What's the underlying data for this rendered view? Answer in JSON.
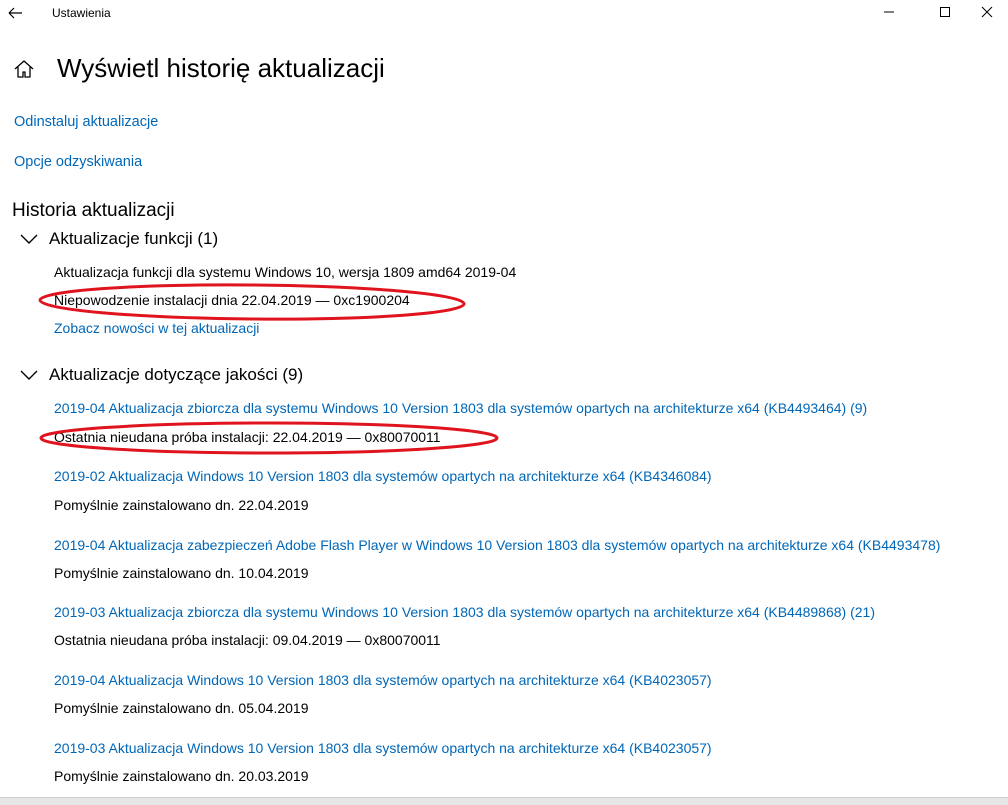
{
  "window": {
    "app_title": "Ustawienia"
  },
  "header": {
    "title": "Wyświetl historię aktualizacji"
  },
  "links": {
    "uninstall": "Odinstaluj aktualizacje",
    "recovery": "Opcje odzyskiwania"
  },
  "history": {
    "title": "Historia aktualizacji",
    "feature_group": {
      "title": "Aktualizacje funkcji (1)",
      "items": [
        {
          "name": "Aktualizacja funkcji dla systemu Windows 10, wersja 1809 amd64 2019-04",
          "status": "Niepowodzenie instalacji dnia 22.04.2019 — 0xc1900204",
          "link": "Zobacz nowości w tej aktualizacji"
        }
      ]
    },
    "quality_group": {
      "title": "Aktualizacje dotyczące jakości (9)",
      "items": [
        {
          "name": "2019-04 Aktualizacja zbiorcza dla systemu Windows 10 Version 1803 dla systemów opartych na architekturze x64 (KB4493464) (9)",
          "status": "Ostatnia nieudana próba instalacji: 22.04.2019 — 0x80070011"
        },
        {
          "name": "2019-02 Aktualizacja Windows 10 Version 1803 dla systemów opartych na architekturze x64 (KB4346084)",
          "status": "Pomyślnie zainstalowano dn. 22.04.2019"
        },
        {
          "name": "2019-04 Aktualizacja zabezpieczeń Adobe Flash Player w Windows 10 Version 1803 dla systemów opartych na architekturze x64 (KB4493478)",
          "status": "Pomyślnie zainstalowano dn. 10.04.2019"
        },
        {
          "name": "2019-03 Aktualizacja zbiorcza dla systemu Windows 10 Version 1803 dla systemów opartych na architekturze x64 (KB4489868) (21)",
          "status": "Ostatnia nieudana próba instalacji: 09.04.2019 — 0x80070011"
        },
        {
          "name": "2019-04 Aktualizacja Windows 10 Version 1803 dla systemów opartych na architekturze x64 (KB4023057)",
          "status": "Pomyślnie zainstalowano dn. 05.04.2019"
        },
        {
          "name": "2019-03 Aktualizacja Windows 10 Version 1803 dla systemów opartych na architekturze x64 (KB4023057)",
          "status": "Pomyślnie zainstalowano dn. 20.03.2019"
        }
      ]
    }
  },
  "colors": {
    "link": "#0067b8",
    "annotation": "#e0141e"
  },
  "icons": [
    "back-arrow-icon",
    "minimize-icon",
    "maximize-icon",
    "close-icon",
    "home-icon",
    "chevron-down-icon"
  ]
}
